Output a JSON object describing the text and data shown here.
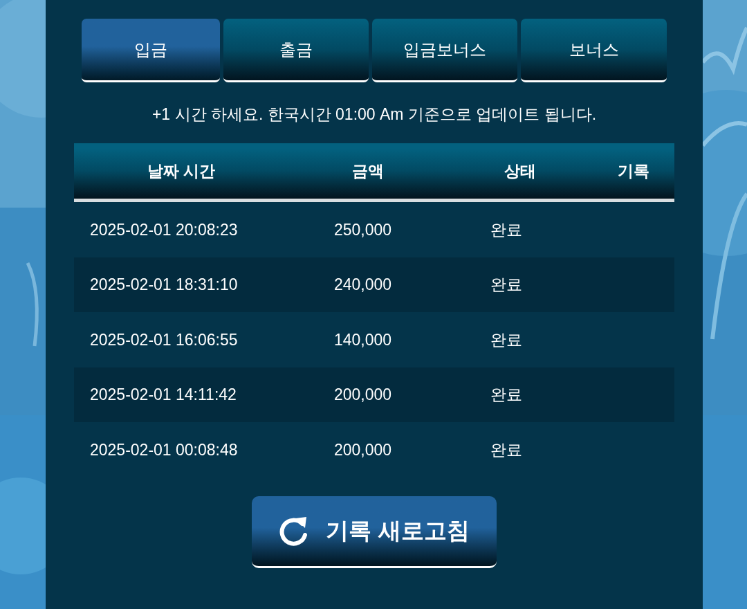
{
  "tabs": [
    {
      "label": "입금",
      "selected": true
    },
    {
      "label": "출금",
      "selected": false
    },
    {
      "label": "입금보너스",
      "selected": false
    },
    {
      "label": "보너스",
      "selected": false
    }
  ],
  "notice": "+1 시간 하세요. 한국시간 01:00 Am 기준으로 업데이트 됩니다.",
  "table": {
    "columns": [
      "날짜 시간",
      "금액",
      "상태",
      "기록"
    ],
    "rows": [
      {
        "date_time": "2025-02-01 20:08:23",
        "amount": "250,000",
        "status": "완료"
      },
      {
        "date_time": "2025-02-01 18:31:10",
        "amount": "240,000",
        "status": "완료"
      },
      {
        "date_time": "2025-02-01 16:06:55",
        "amount": "140,000",
        "status": "완료"
      },
      {
        "date_time": "2025-02-01 14:11:42",
        "amount": "200,000",
        "status": "완료"
      },
      {
        "date_time": "2025-02-01 00:08:48",
        "amount": "200,000",
        "status": "완료"
      }
    ]
  },
  "refresh_button": "기록 새로고침"
}
